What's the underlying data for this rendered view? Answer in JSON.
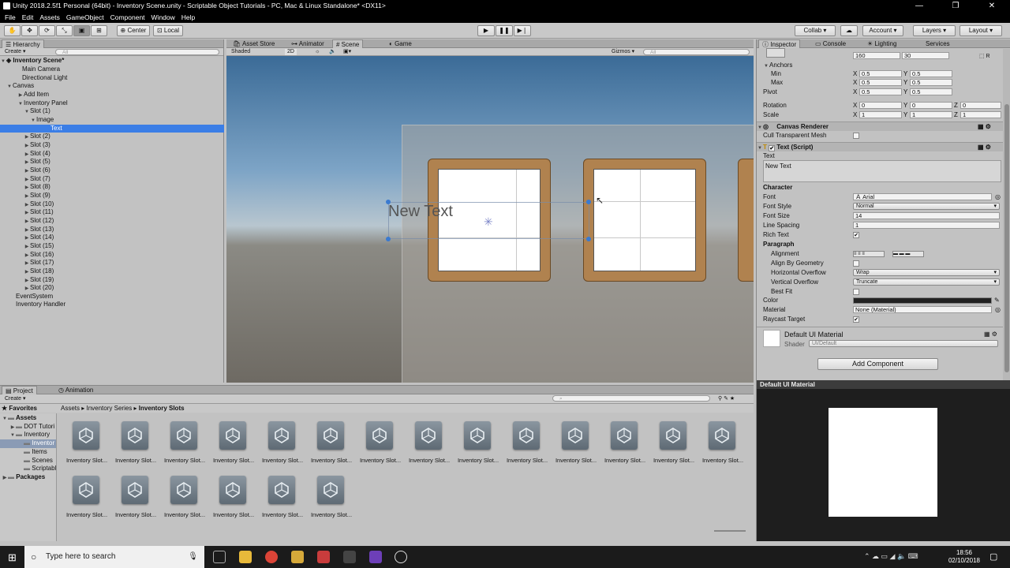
{
  "window": {
    "title": "Unity 2018.2.5f1 Personal (64bit) - Inventory Scene.unity - Scriptable Object Tutorials - PC, Mac & Linux Standalone* <DX11>",
    "controls": [
      "—",
      "❐",
      "✕"
    ]
  },
  "menu": [
    "File",
    "Edit",
    "Assets",
    "GameObject",
    "Component",
    "Window",
    "Help"
  ],
  "toolbar": {
    "pivot": "Center",
    "space": "Local",
    "collab": "Collab ▾",
    "account": "Account",
    "layers": "Layers",
    "layout": "Layout"
  },
  "hierarchy": {
    "tab": "Hierarchy",
    "create": "Create ▾",
    "search_placeholder": "All",
    "scene": "Inventory Scene*",
    "rows": [
      {
        "label": "Main Camera",
        "arrow": ""
      },
      {
        "label": "Directional Light",
        "arrow": ""
      },
      {
        "label": "Canvas",
        "arrow": "▼"
      },
      {
        "label": "Add Item",
        "arrow": "▶"
      },
      {
        "label": "Inventory Panel",
        "arrow": "▼"
      },
      {
        "label": "Slot (1)",
        "arrow": "▼"
      },
      {
        "label": "Image",
        "arrow": "▼"
      },
      {
        "label": "Text",
        "arrow": "",
        "selected": true
      },
      {
        "label": "Slot (2)",
        "arrow": "▶"
      },
      {
        "label": "Slot (3)",
        "arrow": "▶"
      },
      {
        "label": "Slot (4)",
        "arrow": "▶"
      },
      {
        "label": "Slot (5)",
        "arrow": "▶"
      },
      {
        "label": "Slot (6)",
        "arrow": "▶"
      },
      {
        "label": "Slot (7)",
        "arrow": "▶"
      },
      {
        "label": "Slot (8)",
        "arrow": "▶"
      },
      {
        "label": "Slot (9)",
        "arrow": "▶"
      },
      {
        "label": "Slot (10)",
        "arrow": "▶"
      },
      {
        "label": "Slot (11)",
        "arrow": "▶"
      },
      {
        "label": "Slot (12)",
        "arrow": "▶"
      },
      {
        "label": "Slot (13)",
        "arrow": "▶"
      },
      {
        "label": "Slot (14)",
        "arrow": "▶"
      },
      {
        "label": "Slot (15)",
        "arrow": "▶"
      },
      {
        "label": "Slot (16)",
        "arrow": "▶"
      },
      {
        "label": "Slot (17)",
        "arrow": "▶"
      },
      {
        "label": "Slot (18)",
        "arrow": "▶"
      },
      {
        "label": "Slot (19)",
        "arrow": "▶"
      },
      {
        "label": "Slot (20)",
        "arrow": "▶"
      },
      {
        "label": "EventSystem",
        "arrow": ""
      },
      {
        "label": "Inventory Handler",
        "arrow": ""
      }
    ]
  },
  "scene_view": {
    "tabs": [
      "Asset Store",
      "Animator",
      "Scene",
      "Game"
    ],
    "active_tab": "Scene",
    "shading": "Shaded",
    "mode_2d": "2D",
    "gizmos": "Gizmos ▾",
    "search_placeholder": "All",
    "selected_text": "New Text"
  },
  "inspector": {
    "tabs": [
      "Inspector",
      "Console",
      "Lighting",
      "Services"
    ],
    "rect": {
      "width": "160",
      "height": "30"
    },
    "anchors": {
      "label": "Anchors",
      "min_label": "Min",
      "max_label": "Max",
      "min_x": "0.5",
      "min_y": "0.5",
      "max_x": "0.5",
      "max_y": "0.5"
    },
    "pivot": {
      "label": "Pivot",
      "x": "0.5",
      "y": "0.5"
    },
    "rotation": {
      "label": "Rotation",
      "x": "0",
      "y": "0",
      "z": "0"
    },
    "scale": {
      "label": "Scale",
      "x": "1",
      "y": "1",
      "z": "1"
    },
    "canvas_renderer": {
      "title": "Canvas Renderer",
      "cull_label": "Cull Transparent Mesh"
    },
    "text_script": {
      "title": "Text (Script)",
      "text_label": "Text",
      "text_value": "New Text",
      "character": "Character",
      "font_label": "Font",
      "font_value": "Arial",
      "font_style_label": "Font Style",
      "font_style_value": "Normal",
      "font_size_label": "Font Size",
      "font_size_value": "14",
      "line_spacing_label": "Line Spacing",
      "line_spacing_value": "1",
      "rich_text_label": "Rich Text",
      "paragraph": "Paragraph",
      "alignment_label": "Alignment",
      "align_geometry_label": "Align By Geometry",
      "h_overflow_label": "Horizontal Overflow",
      "h_overflow_value": "Wrap",
      "v_overflow_label": "Vertical Overflow",
      "v_overflow_value": "Truncate",
      "best_fit_label": "Best Fit",
      "color_label": "Color",
      "material_label": "Material",
      "material_value": "None (Material)",
      "raycast_label": "Raycast Target"
    },
    "material": {
      "name": "Default UI Material",
      "shader_label": "Shader",
      "shader_value": "UI/Default"
    },
    "add_component": "Add Component",
    "preview_title": "Default UI Material"
  },
  "project": {
    "tabs": [
      "Project",
      "Animation"
    ],
    "create": "Create ▾",
    "favorites": "Favorites",
    "breadcrumb": [
      "Assets",
      "Inventory Series",
      "Inventory Slots"
    ],
    "tree": [
      {
        "label": "Assets",
        "arrow": "▼",
        "bold": true
      },
      {
        "label": "DOT Tutori",
        "arrow": "▶"
      },
      {
        "label": "Inventory",
        "arrow": "▼"
      },
      {
        "label": "Inventor",
        "arrow": "",
        "selected": true
      },
      {
        "label": "Items",
        "arrow": ""
      },
      {
        "label": "Scenes",
        "arrow": ""
      },
      {
        "label": "Scriptable",
        "arrow": ""
      },
      {
        "label": "Packages",
        "arrow": "▶",
        "bold": true
      }
    ],
    "assets": [
      "Inventory Slot...",
      "Inventory Slot...",
      "Inventory Slot...",
      "Inventory Slot...",
      "Inventory Slot...",
      "Inventory Slot...",
      "Inventory Slot...",
      "Inventory Slot...",
      "Inventory Slot...",
      "Inventory Slot...",
      "Inventory Slot...",
      "Inventory Slot...",
      "Inventory Slot...",
      "Inventory Slot...",
      "Inventory Slot...",
      "Inventory Slot...",
      "Inventory Slot...",
      "Inventory Slot...",
      "Inventory Slot...",
      "Inventory Slot..."
    ]
  },
  "taskbar": {
    "search_placeholder": "Type here to search",
    "time": "18:56",
    "date": "02/10/2018"
  },
  "colors": {
    "selection": "#3b7ee6",
    "slot_frame": "#b0824f",
    "panel_bg": "#c2c2c2"
  }
}
